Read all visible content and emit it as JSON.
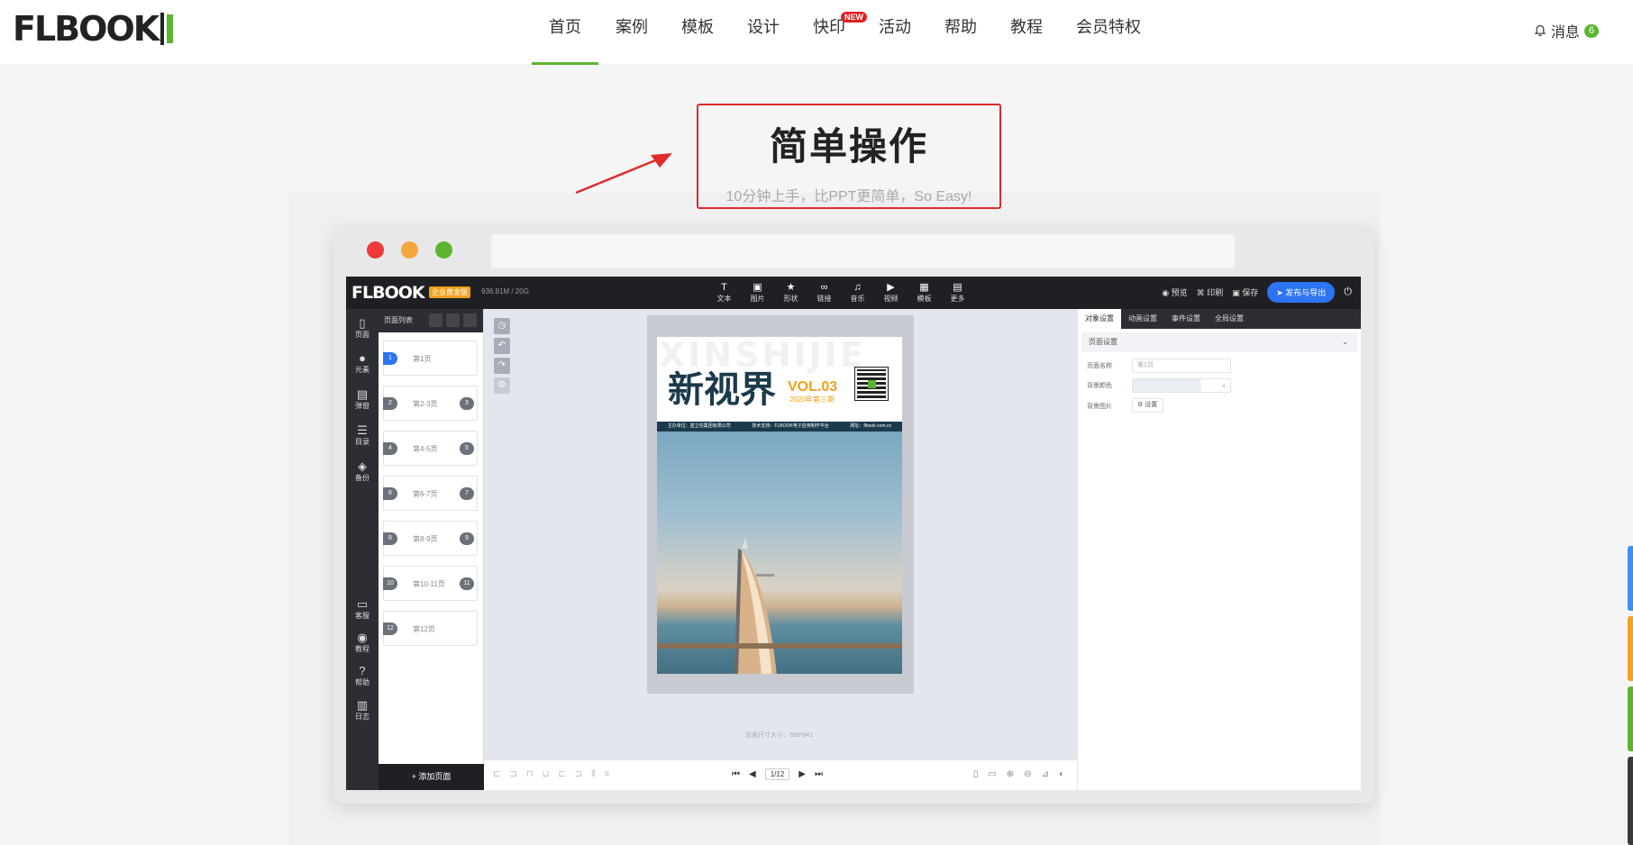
{
  "logo": {
    "text": "FLBOOK"
  },
  "nav": {
    "items": [
      "首页",
      "案例",
      "模板",
      "设计",
      "快印",
      "活动",
      "帮助",
      "教程",
      "会员特权"
    ],
    "new_badge": "NEW"
  },
  "messages": {
    "label": "消息",
    "count": "6"
  },
  "hero": {
    "title": "简单操作",
    "subtitle": "10分钟上手，比PPT更简单，So Easy!"
  },
  "editor": {
    "logo": "FLBOOK",
    "edition": "企业黄金版",
    "capacity": "936.81M / 20G",
    "tools": [
      {
        "icon": "T",
        "label": "文本"
      },
      {
        "icon": "▣",
        "label": "图片"
      },
      {
        "icon": "★",
        "label": "形状"
      },
      {
        "icon": "∞",
        "label": "链接"
      },
      {
        "icon": "♫",
        "label": "音乐"
      },
      {
        "icon": "▶",
        "label": "视频"
      },
      {
        "icon": "▦",
        "label": "模板"
      },
      {
        "icon": "▤",
        "label": "更多"
      }
    ],
    "right_tools": {
      "preview": "预览",
      "print": "印刷",
      "save": "保存",
      "publish": "发布与导出"
    },
    "left_nav": [
      "页面",
      "元素",
      "弹窗",
      "目录",
      "备份"
    ],
    "left_nav_bottom": [
      "客服",
      "教程",
      "帮助",
      "日志"
    ],
    "page_list": {
      "title": "页面列表",
      "items": [
        {
          "l": "1",
          "label": "第1页",
          "r": ""
        },
        {
          "l": "2",
          "label": "第2-3页",
          "r": "3"
        },
        {
          "l": "4",
          "label": "第4-5页",
          "r": "5"
        },
        {
          "l": "6",
          "label": "第6-7页",
          "r": "7"
        },
        {
          "l": "8",
          "label": "第8-9页",
          "r": "9"
        },
        {
          "l": "10",
          "label": "第10-11页",
          "r": "11"
        },
        {
          "l": "12",
          "label": "第12页",
          "r": ""
        }
      ],
      "add_page": "+ 添加页面"
    },
    "magazine": {
      "watermark": "XINSHIJIE",
      "title": "新视界",
      "vol": "VOL.03",
      "issue": "2020年第三期",
      "strip": [
        "主办单位：蓝立信集团有限公司",
        "技术支持：FLBOOK电子应用制作平台",
        "网址：flbook.com.cn"
      ]
    },
    "page_size": "页面尺寸大小：598*841",
    "pager": "1/12",
    "right_panel": {
      "tabs": [
        "对象设置",
        "动画设置",
        "事件设置",
        "全局设置"
      ],
      "section": "页面设置",
      "fields": {
        "name_label": "页面名称",
        "name_value": "第1页",
        "bg_color_label": "背景颜色",
        "bg_image_label": "背景图片",
        "set_button": "设置"
      }
    }
  }
}
